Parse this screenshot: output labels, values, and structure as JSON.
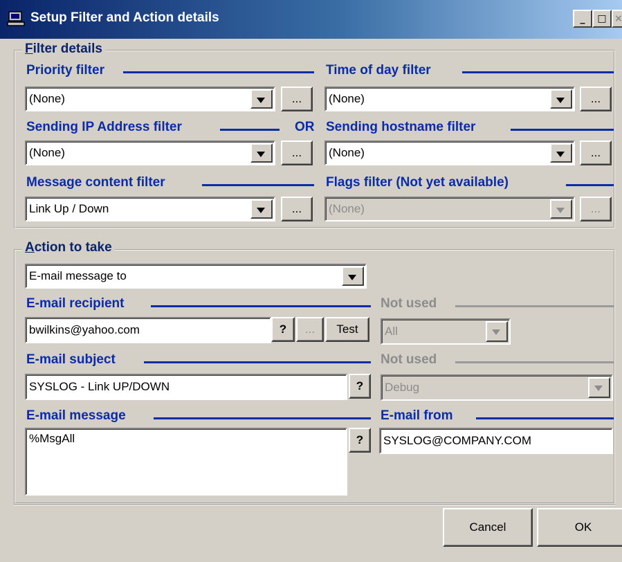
{
  "window": {
    "title": "Setup Filter and Action details",
    "min": "_",
    "max": "□",
    "close": "×"
  },
  "filter": {
    "group_title": "Filter details",
    "priority": {
      "label": "Priority filter",
      "value": "(None)"
    },
    "time_of_day": {
      "label": "Time of day filter",
      "value": "(None)"
    },
    "sending_ip": {
      "label": "Sending IP Address filter",
      "value": "(None)"
    },
    "or_label": "OR",
    "sending_hostname": {
      "label": "Sending hostname filter",
      "value": "(None)"
    },
    "message_content": {
      "label": "Message content filter",
      "value": "Link Up / Down"
    },
    "flags": {
      "label": "Flags filter (Not yet available)",
      "value": "(None)"
    },
    "browse_label": "..."
  },
  "action": {
    "group_title": "Action to take",
    "type_value": "E-mail message to",
    "recipient": {
      "label": "E-mail recipient",
      "value": "bwilkins@yahoo.com"
    },
    "help_label": "?",
    "browse_label": "...",
    "test_label": "Test",
    "not_used_1": {
      "label": "Not used",
      "value": "All"
    },
    "subject": {
      "label": "E-mail subject",
      "value": "SYSLOG - Link UP/DOWN"
    },
    "not_used_2": {
      "label": "Not used",
      "value": "Debug"
    },
    "message": {
      "label": "E-mail message",
      "value": "%MsgAll"
    },
    "from": {
      "label": "E-mail from",
      "value": "SYSLOG@COMPANY.COM"
    }
  },
  "buttons": {
    "cancel": "Cancel",
    "ok": "OK"
  },
  "colors": {
    "label_blue": "#0b2ca8",
    "title_bar": "#0a246a",
    "face": "#d4d0c8"
  }
}
